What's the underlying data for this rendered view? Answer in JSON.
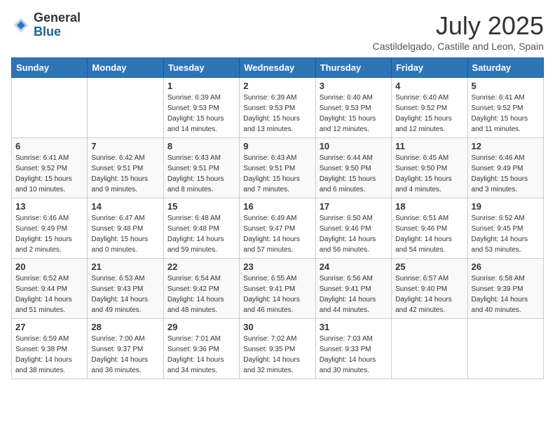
{
  "logo": {
    "general": "General",
    "blue": "Blue"
  },
  "header": {
    "month": "July 2025",
    "location": "Castildelgado, Castille and Leon, Spain"
  },
  "days_of_week": [
    "Sunday",
    "Monday",
    "Tuesday",
    "Wednesday",
    "Thursday",
    "Friday",
    "Saturday"
  ],
  "weeks": [
    [
      {
        "day": "",
        "sunrise": "",
        "sunset": "",
        "daylight": ""
      },
      {
        "day": "",
        "sunrise": "",
        "sunset": "",
        "daylight": ""
      },
      {
        "day": "1",
        "sunrise": "Sunrise: 6:39 AM",
        "sunset": "Sunset: 9:53 PM",
        "daylight": "Daylight: 15 hours and 14 minutes."
      },
      {
        "day": "2",
        "sunrise": "Sunrise: 6:39 AM",
        "sunset": "Sunset: 9:53 PM",
        "daylight": "Daylight: 15 hours and 13 minutes."
      },
      {
        "day": "3",
        "sunrise": "Sunrise: 6:40 AM",
        "sunset": "Sunset: 9:53 PM",
        "daylight": "Daylight: 15 hours and 12 minutes."
      },
      {
        "day": "4",
        "sunrise": "Sunrise: 6:40 AM",
        "sunset": "Sunset: 9:52 PM",
        "daylight": "Daylight: 15 hours and 12 minutes."
      },
      {
        "day": "5",
        "sunrise": "Sunrise: 6:41 AM",
        "sunset": "Sunset: 9:52 PM",
        "daylight": "Daylight: 15 hours and 11 minutes."
      }
    ],
    [
      {
        "day": "6",
        "sunrise": "Sunrise: 6:41 AM",
        "sunset": "Sunset: 9:52 PM",
        "daylight": "Daylight: 15 hours and 10 minutes."
      },
      {
        "day": "7",
        "sunrise": "Sunrise: 6:42 AM",
        "sunset": "Sunset: 9:51 PM",
        "daylight": "Daylight: 15 hours and 9 minutes."
      },
      {
        "day": "8",
        "sunrise": "Sunrise: 6:43 AM",
        "sunset": "Sunset: 9:51 PM",
        "daylight": "Daylight: 15 hours and 8 minutes."
      },
      {
        "day": "9",
        "sunrise": "Sunrise: 6:43 AM",
        "sunset": "Sunset: 9:51 PM",
        "daylight": "Daylight: 15 hours and 7 minutes."
      },
      {
        "day": "10",
        "sunrise": "Sunrise: 6:44 AM",
        "sunset": "Sunset: 9:50 PM",
        "daylight": "Daylight: 15 hours and 6 minutes."
      },
      {
        "day": "11",
        "sunrise": "Sunrise: 6:45 AM",
        "sunset": "Sunset: 9:50 PM",
        "daylight": "Daylight: 15 hours and 4 minutes."
      },
      {
        "day": "12",
        "sunrise": "Sunrise: 6:46 AM",
        "sunset": "Sunset: 9:49 PM",
        "daylight": "Daylight: 15 hours and 3 minutes."
      }
    ],
    [
      {
        "day": "13",
        "sunrise": "Sunrise: 6:46 AM",
        "sunset": "Sunset: 9:49 PM",
        "daylight": "Daylight: 15 hours and 2 minutes."
      },
      {
        "day": "14",
        "sunrise": "Sunrise: 6:47 AM",
        "sunset": "Sunset: 9:48 PM",
        "daylight": "Daylight: 15 hours and 0 minutes."
      },
      {
        "day": "15",
        "sunrise": "Sunrise: 6:48 AM",
        "sunset": "Sunset: 9:48 PM",
        "daylight": "Daylight: 14 hours and 59 minutes."
      },
      {
        "day": "16",
        "sunrise": "Sunrise: 6:49 AM",
        "sunset": "Sunset: 9:47 PM",
        "daylight": "Daylight: 14 hours and 57 minutes."
      },
      {
        "day": "17",
        "sunrise": "Sunrise: 6:50 AM",
        "sunset": "Sunset: 9:46 PM",
        "daylight": "Daylight: 14 hours and 56 minutes."
      },
      {
        "day": "18",
        "sunrise": "Sunrise: 6:51 AM",
        "sunset": "Sunset: 9:46 PM",
        "daylight": "Daylight: 14 hours and 54 minutes."
      },
      {
        "day": "19",
        "sunrise": "Sunrise: 6:52 AM",
        "sunset": "Sunset: 9:45 PM",
        "daylight": "Daylight: 14 hours and 53 minutes."
      }
    ],
    [
      {
        "day": "20",
        "sunrise": "Sunrise: 6:52 AM",
        "sunset": "Sunset: 9:44 PM",
        "daylight": "Daylight: 14 hours and 51 minutes."
      },
      {
        "day": "21",
        "sunrise": "Sunrise: 6:53 AM",
        "sunset": "Sunset: 9:43 PM",
        "daylight": "Daylight: 14 hours and 49 minutes."
      },
      {
        "day": "22",
        "sunrise": "Sunrise: 6:54 AM",
        "sunset": "Sunset: 9:42 PM",
        "daylight": "Daylight: 14 hours and 48 minutes."
      },
      {
        "day": "23",
        "sunrise": "Sunrise: 6:55 AM",
        "sunset": "Sunset: 9:41 PM",
        "daylight": "Daylight: 14 hours and 46 minutes."
      },
      {
        "day": "24",
        "sunrise": "Sunrise: 6:56 AM",
        "sunset": "Sunset: 9:41 PM",
        "daylight": "Daylight: 14 hours and 44 minutes."
      },
      {
        "day": "25",
        "sunrise": "Sunrise: 6:57 AM",
        "sunset": "Sunset: 9:40 PM",
        "daylight": "Daylight: 14 hours and 42 minutes."
      },
      {
        "day": "26",
        "sunrise": "Sunrise: 6:58 AM",
        "sunset": "Sunset: 9:39 PM",
        "daylight": "Daylight: 14 hours and 40 minutes."
      }
    ],
    [
      {
        "day": "27",
        "sunrise": "Sunrise: 6:59 AM",
        "sunset": "Sunset: 9:38 PM",
        "daylight": "Daylight: 14 hours and 38 minutes."
      },
      {
        "day": "28",
        "sunrise": "Sunrise: 7:00 AM",
        "sunset": "Sunset: 9:37 PM",
        "daylight": "Daylight: 14 hours and 36 minutes."
      },
      {
        "day": "29",
        "sunrise": "Sunrise: 7:01 AM",
        "sunset": "Sunset: 9:36 PM",
        "daylight": "Daylight: 14 hours and 34 minutes."
      },
      {
        "day": "30",
        "sunrise": "Sunrise: 7:02 AM",
        "sunset": "Sunset: 9:35 PM",
        "daylight": "Daylight: 14 hours and 32 minutes."
      },
      {
        "day": "31",
        "sunrise": "Sunrise: 7:03 AM",
        "sunset": "Sunset: 9:33 PM",
        "daylight": "Daylight: 14 hours and 30 minutes."
      },
      {
        "day": "",
        "sunrise": "",
        "sunset": "",
        "daylight": ""
      },
      {
        "day": "",
        "sunrise": "",
        "sunset": "",
        "daylight": ""
      }
    ]
  ]
}
